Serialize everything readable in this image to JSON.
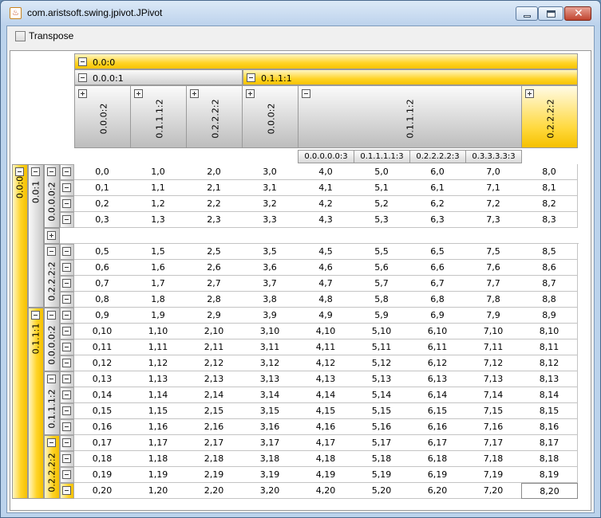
{
  "window": {
    "title": "com.aristsoft.swing.jpivot.JPivot",
    "icon": "java-cup-icon",
    "buttons": [
      "minimize-icon",
      "maximize-icon",
      "close-icon"
    ]
  },
  "toolbar": {
    "transpose_label": "Transpose",
    "transpose_checked": false
  },
  "pivot": {
    "col_header_level0": "0.0:0",
    "col_header_level1": [
      "0.0.0:1",
      "0.1.1:1"
    ],
    "col_header_level2": [
      "0.0.0:2",
      "0.1.1.1:2",
      "0.2.2.2:2",
      "0.0.0:2",
      "0.1.1.1:2",
      "0.2.2.2:2"
    ],
    "col_header_level3": [
      "0.0.0.0.0:3",
      "0.1.1.1.1:3",
      "0.2.2.2.2:3",
      "0.3.3.3.3:3"
    ],
    "row_header_level0": "0.0:0",
    "row_header_level1": [
      "0.0:1",
      "0.1.1:1"
    ],
    "row_header_level2": [
      "0.0.0.0:2",
      "0.2.2.2:2",
      "0.0.0.0:2",
      "0.1.1.1:2",
      "0.2.2.2:2"
    ],
    "rows": [
      [
        "0,0",
        "1,0",
        "2,0",
        "3,0",
        "4,0",
        "5,0",
        "6,0",
        "7,0",
        "8,0"
      ],
      [
        "0,1",
        "1,1",
        "2,1",
        "3,1",
        "4,1",
        "5,1",
        "6,1",
        "7,1",
        "8,1"
      ],
      [
        "0,2",
        "1,2",
        "2,2",
        "3,2",
        "4,2",
        "5,2",
        "6,2",
        "7,2",
        "8,2"
      ],
      [
        "0,3",
        "1,3",
        "2,3",
        "3,3",
        "4,3",
        "5,3",
        "6,3",
        "7,3",
        "8,3"
      ],
      [],
      [
        "0,5",
        "1,5",
        "2,5",
        "3,5",
        "4,5",
        "5,5",
        "6,5",
        "7,5",
        "8,5"
      ],
      [
        "0,6",
        "1,6",
        "2,6",
        "3,6",
        "4,6",
        "5,6",
        "6,6",
        "7,6",
        "8,6"
      ],
      [
        "0,7",
        "1,7",
        "2,7",
        "3,7",
        "4,7",
        "5,7",
        "6,7",
        "7,7",
        "8,7"
      ],
      [
        "0,8",
        "1,8",
        "2,8",
        "3,8",
        "4,8",
        "5,8",
        "6,8",
        "7,8",
        "8,8"
      ],
      [
        "0,9",
        "1,9",
        "2,9",
        "3,9",
        "4,9",
        "5,9",
        "6,9",
        "7,9",
        "8,9"
      ],
      [
        "0,10",
        "1,10",
        "2,10",
        "3,10",
        "4,10",
        "5,10",
        "6,10",
        "7,10",
        "8,10"
      ],
      [
        "0,11",
        "1,11",
        "2,11",
        "3,11",
        "4,11",
        "5,11",
        "6,11",
        "7,11",
        "8,11"
      ],
      [
        "0,12",
        "1,12",
        "2,12",
        "3,12",
        "4,12",
        "5,12",
        "6,12",
        "7,12",
        "8,12"
      ],
      [
        "0,13",
        "1,13",
        "2,13",
        "3,13",
        "4,13",
        "5,13",
        "6,13",
        "7,13",
        "8,13"
      ],
      [
        "0,14",
        "1,14",
        "2,14",
        "3,14",
        "4,14",
        "5,14",
        "6,14",
        "7,14",
        "8,14"
      ],
      [
        "0,15",
        "1,15",
        "2,15",
        "3,15",
        "4,15",
        "5,15",
        "6,15",
        "7,15",
        "8,15"
      ],
      [
        "0,16",
        "1,16",
        "2,16",
        "3,16",
        "4,16",
        "5,16",
        "6,16",
        "7,16",
        "8,16"
      ],
      [
        "0,17",
        "1,17",
        "2,17",
        "3,17",
        "4,17",
        "5,17",
        "6,17",
        "7,17",
        "8,17"
      ],
      [
        "0,18",
        "1,18",
        "2,18",
        "3,18",
        "4,18",
        "5,18",
        "6,18",
        "7,18",
        "8,18"
      ],
      [
        "0,19",
        "1,19",
        "2,19",
        "3,19",
        "4,19",
        "5,19",
        "6,19",
        "7,19",
        "8,19"
      ],
      [
        "0,20",
        "1,20",
        "2,20",
        "3,20",
        "4,20",
        "5,20",
        "6,20",
        "7,20",
        "8,20"
      ]
    ]
  },
  "colors": {
    "highlight": "#ffd427",
    "header_gray": "#d0d0d0",
    "grid": "#c4c4c4"
  }
}
